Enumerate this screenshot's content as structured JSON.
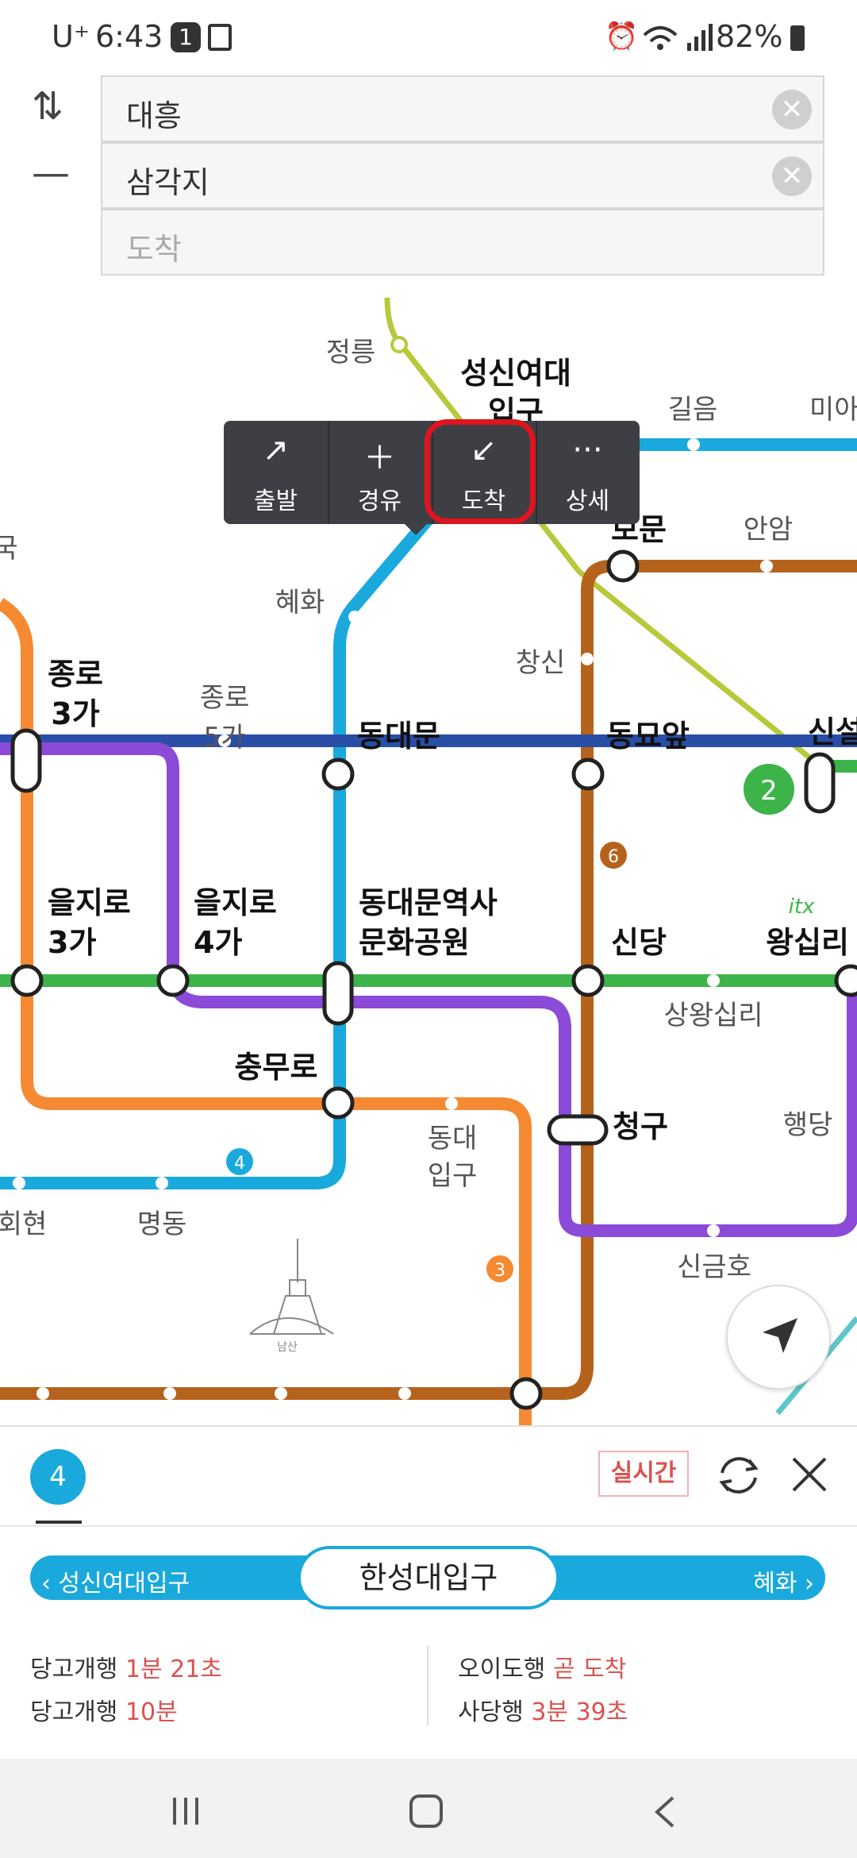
{
  "status_bar": {
    "carrier": "U⁺",
    "time": "6:43",
    "notif_count": "1",
    "battery": "82%"
  },
  "search": {
    "origin_value": "대흥",
    "waypoint_value": "삼각지",
    "destination_placeholder": "도착"
  },
  "popup": {
    "start_label": "출발",
    "via_label": "경유",
    "arrive_label": "도착",
    "detail_label": "상세"
  },
  "map": {
    "stations": {
      "jeongneung": "정릉",
      "sungshin_1": "성신여대",
      "sungshin_2": "입구",
      "gileum": "길음",
      "mia": "미아",
      "anguk": "안국",
      "bomun": "보문",
      "anam": "안암",
      "hyehwa": "혜화",
      "changsin": "창신",
      "jongno3_1": "종로",
      "jongno3_2": "3가",
      "jongno5_1": "종로",
      "jongno5_2": "5가",
      "dongdaemun": "동대문",
      "dongmyo": "동묘앞",
      "sinseol": "신설",
      "euljiro3_1": "을지로",
      "euljiro3_2": "3가",
      "euljiro4_1": "을지로",
      "euljiro4_2": "4가",
      "ddp_1": "동대문역사",
      "ddp_2": "문화공원",
      "sindang": "신당",
      "wangsimni": "왕십리",
      "sangwangsimni": "상왕십리",
      "chungmuro": "충무로",
      "dongguk_1": "동대",
      "dongguk_2": "입구",
      "cheonggu": "청구",
      "haengdang": "행당",
      "hoehyeon": "회현",
      "myeongdong": "명동",
      "singeumho": "신금호",
      "namsan": "남산",
      "itx": "itx"
    },
    "line_badges": {
      "line2": "2",
      "line3": "3",
      "line4": "4",
      "line6": "6"
    }
  },
  "panel": {
    "line_number": "4",
    "realtime_label": "실시간",
    "prev_station": "성신여대입구",
    "current_station": "한성대입구",
    "next_station": "혜화",
    "arrivals": [
      {
        "dest": "당고개행",
        "time": "1분 21초"
      },
      {
        "dest": "당고개행",
        "time": "10분"
      },
      {
        "dest": "오이도행",
        "time": "곧 도착"
      },
      {
        "dest": "사당행",
        "time": "3분 39초"
      }
    ]
  },
  "colors": {
    "line1": "#2a4ea6",
    "line2": "#3cb44a",
    "line3": "#f58a33",
    "line4": "#1aa9dc",
    "line5": "#8b4ad8",
    "line6": "#b5631c",
    "ui_sinbundang": "#b7c93a",
    "highlight_red": "#e0141e",
    "realtime_red": "#d9534f"
  }
}
